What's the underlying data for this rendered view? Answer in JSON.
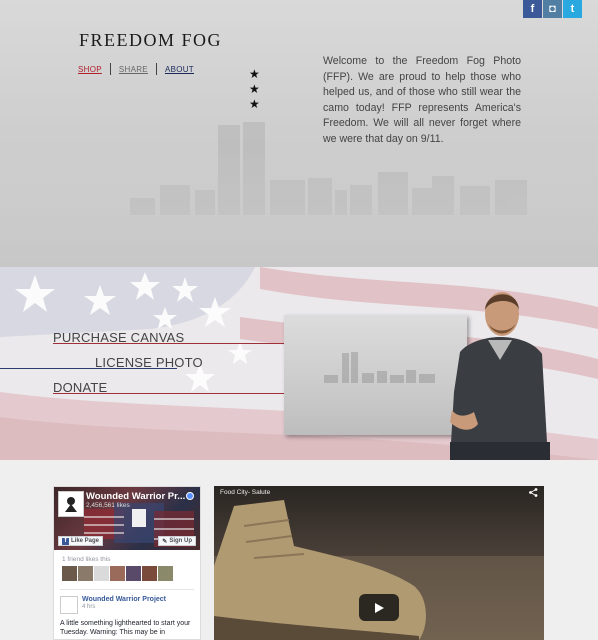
{
  "header": {
    "brand": "FREEDOM FOG",
    "nav": {
      "shop": "SHOP",
      "share": "SHARE",
      "about": "ABOUT"
    },
    "stars": [
      "★",
      "★",
      "★"
    ],
    "intro": "Welcome to the Freedom Fog Photo (FFP). We are proud to help those who helped us, and of those who still wear the camo today! FFP represents America's Freedom. We will all never forget where we were that day on 9/11.",
    "social": {
      "facebook": "f",
      "instagram": "◘",
      "twitter": "t"
    }
  },
  "menu": {
    "purchase": "PURCHASE CANVAS",
    "license": "LICENSE PHOTO",
    "donate": "DONATE"
  },
  "facebook_widget": {
    "page_name": "Wounded Warrior Pr...",
    "likes": "2,456,561 likes",
    "like_button": "Like Page",
    "signup_button": "Sign Up",
    "friends_text": "1 friend likes this",
    "post_author": "Wounded Warrior Project",
    "post_time": "4 hrs",
    "post_text": "A little something lighthearted to start your Tuesday. Warning: This may be in"
  },
  "video": {
    "title": "Food City- Salute",
    "share_icon": "share-icon"
  },
  "colors": {
    "facebook": "#3b5998",
    "instagram": "#517fa4",
    "twitter": "#2aa9e0",
    "nav_shop": "#b0222e",
    "menu_red": "#a03038",
    "menu_blue": "#2a3c70"
  }
}
